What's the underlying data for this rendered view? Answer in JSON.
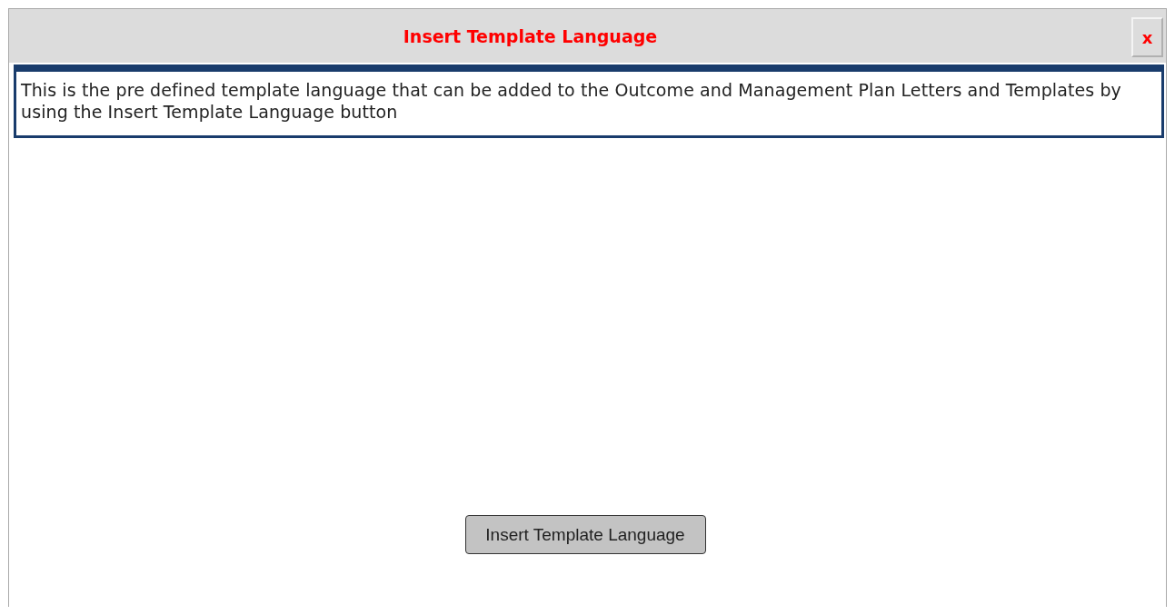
{
  "dialog": {
    "title": "Insert Template Language",
    "close_label": "x"
  },
  "description": "This is the pre defined template language that can be added to the Outcome and Management Plan Letters and Templates by using the Insert Template Language button",
  "buttons": [
    "Insert Template Language"
  ]
}
